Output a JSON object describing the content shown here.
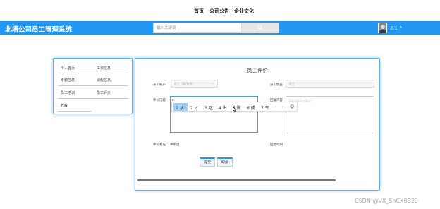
{
  "topnav": {
    "items": [
      "首页",
      "公司公告",
      "企业文化"
    ]
  },
  "header": {
    "brand": "北塔公司员工管理系统",
    "search_placeholder": "输入关键词",
    "user_name": "员工",
    "caret": "▾"
  },
  "sidebar": {
    "items": [
      {
        "label": "个人首页"
      },
      {
        "label": "工资信息"
      },
      {
        "label": "考勤信息"
      },
      {
        "label": "请假信息"
      },
      {
        "label": "员工培训"
      },
      {
        "label": "员工评价"
      },
      {
        "label": "收藏"
      }
    ]
  },
  "form": {
    "title": "员工评价",
    "employee_account_label": "员工账户",
    "employee_account_placeholder": "员工（ID/账号）",
    "employee_name_label": "员工姓名",
    "employee_name_placeholder": "员工",
    "comment_label": "评价内容",
    "comment_value": "c",
    "reply_label": "回复内容",
    "reply_placeholder": "回复内容为空暂无",
    "evaluator_label": "评价者名",
    "evaluator_value": "评审组",
    "reply_time_label": "回复时间",
    "submit_label": "提交",
    "cancel_label": "取消"
  },
  "ime": {
    "candidates": [
      "1 从",
      "2 才",
      "3 吃",
      "4 出",
      "5 陈",
      "6 成",
      "7 车"
    ],
    "prev": "‹",
    "next": "›",
    "emoji": "☺"
  },
  "watermark": "CSDN @VX_ShCX8820",
  "colors": {
    "accent": "#2196f3",
    "panel_border": "#5cb3ee"
  }
}
